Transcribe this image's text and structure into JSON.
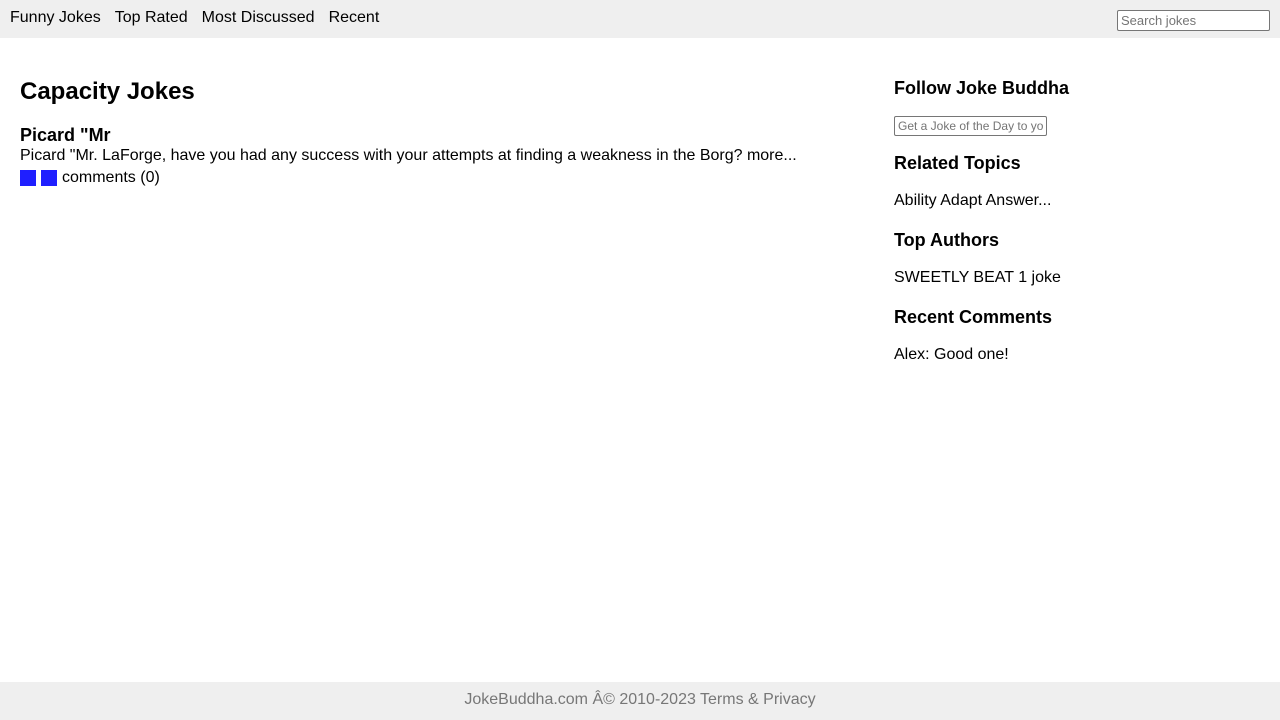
{
  "nav": {
    "items": [
      "Funny Jokes",
      "Top Rated",
      "Most Discussed",
      "Recent"
    ],
    "search_placeholder": "Search jokes"
  },
  "main": {
    "title": "Capacity Jokes",
    "joke": {
      "title": "Picard \"Mr",
      "text": "Picard \"Mr. LaForge, have you had any success with your attempts at finding a weakness in the Borg? more...",
      "comments": "comments (0)",
      "square_color": "#1f1fff"
    }
  },
  "sidebar": {
    "follow_title": "Follow Joke Buddha",
    "follow_placeholder": "Get a Joke of the Day to your inbox",
    "related_title": "Related Topics",
    "related_text": "Ability Adapt Answer...",
    "authors_title": "Top Authors",
    "authors_text": "SWEETLY BEAT 1 joke",
    "comments_title": "Recent Comments",
    "comments_text": "Alex: Good one!"
  },
  "footer": {
    "text": "JokeBuddha.com Â© 2010-2023 Terms & Privacy"
  }
}
